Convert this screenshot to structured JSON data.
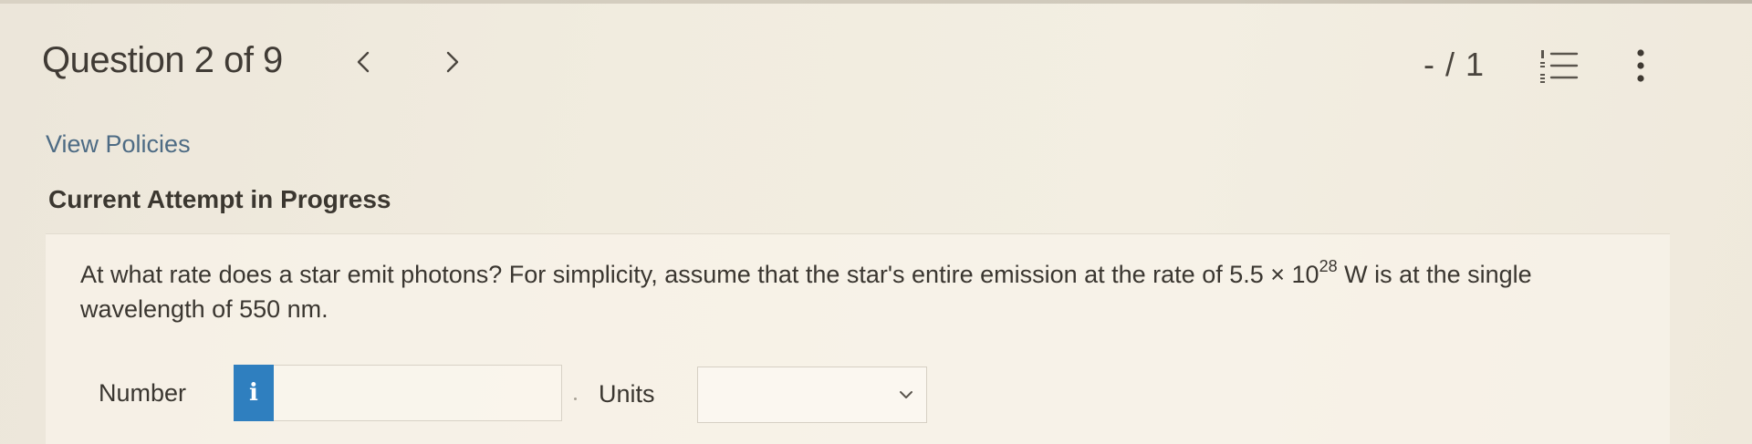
{
  "header": {
    "question_title": "Question 2 of 9",
    "prev_icon": "chevron-left-icon",
    "next_icon": "chevron-right-icon",
    "score": "- / 1",
    "list_icon": "numbered-list-icon",
    "more_icon": "kebab-menu-icon"
  },
  "links": {
    "view_policies": "View Policies"
  },
  "attempt": {
    "status": "Current Attempt in Progress"
  },
  "question": {
    "text_before": "At what rate does a star emit photons? For simplicity, assume that the star's entire emission at the rate of 5.5 × 10",
    "exponent": "28",
    "text_after": " W is at the single wavelength of 550 nm."
  },
  "answer": {
    "number_label": "Number",
    "info_icon": "info-icon",
    "info_glyph": "i",
    "number_value": "",
    "units_label": "Units",
    "units_selected": "",
    "units_icon": "chevron-down-icon"
  },
  "colors": {
    "accent_blue": "#2f7fbf",
    "link": "#4d6b84",
    "background": "#f1ecdf"
  }
}
